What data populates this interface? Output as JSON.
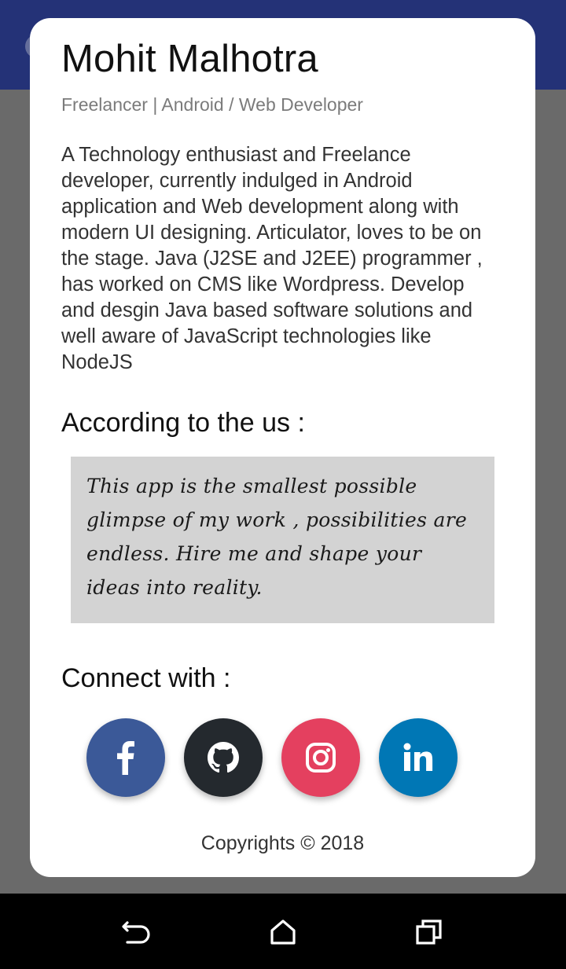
{
  "profile": {
    "name": "Mohit Malhotra",
    "subtitle": "Freelancer | Android / Web Developer",
    "bio": "A Technology enthusiast and Freelance developer, currently indulged in Android application and Web development along with modern UI designing. Articulator, loves to be on the stage. Java (J2SE and J2EE) programmer , has worked on CMS like Wordpress. Develop and desgin Java based software solutions and well aware of JavaScript technologies like NodeJS"
  },
  "according": {
    "heading": "According to the us :",
    "quote": "This app is the smallest possible glimpse of my work , possibilities are endless. Hire me and shape your ideas into reality."
  },
  "connect": {
    "heading": "Connect with :",
    "buttons": [
      {
        "icon": "facebook-icon",
        "color": "#3b5998"
      },
      {
        "icon": "github-icon",
        "color": "#24292e"
      },
      {
        "icon": "instagram-icon",
        "color": "#e4405f"
      },
      {
        "icon": "linkedin-icon",
        "color": "#0077b5"
      }
    ]
  },
  "footer": {
    "copyright": "Copyrights © 2018"
  },
  "nav": {
    "icons": [
      "back-icon",
      "home-icon",
      "recents-icon"
    ]
  },
  "colors": {
    "header": "#243277",
    "scrim": "#686868",
    "quote_bg": "#d3d3d3"
  }
}
